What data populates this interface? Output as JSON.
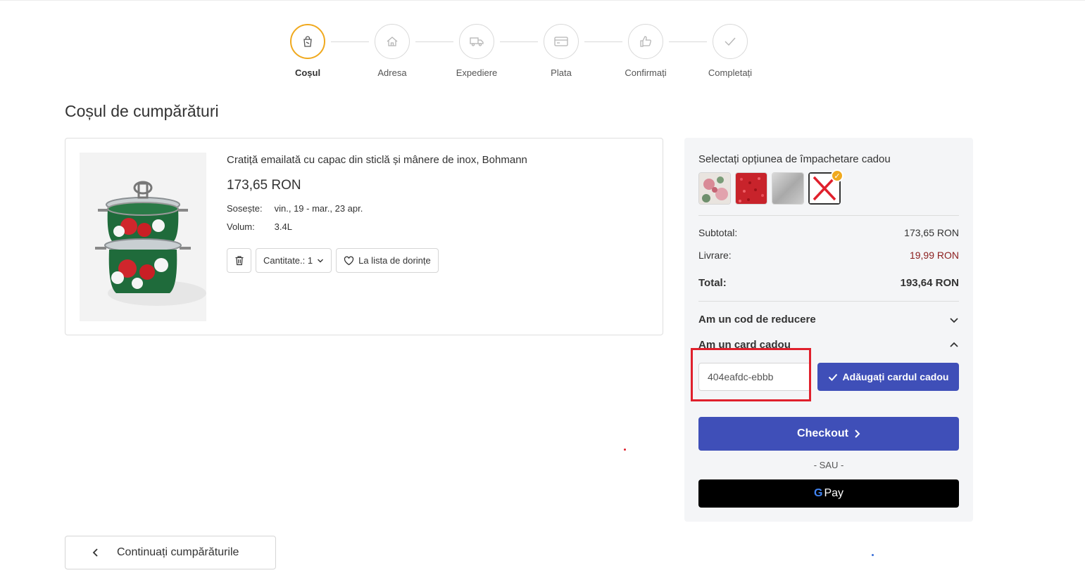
{
  "stepper": {
    "steps": [
      {
        "label": "Coșul",
        "icon": "shopping-bag-icon",
        "active": true
      },
      {
        "label": "Adresa",
        "icon": "home-icon",
        "active": false
      },
      {
        "label": "Expediere",
        "icon": "truck-icon",
        "active": false
      },
      {
        "label": "Plata",
        "icon": "credit-card-icon",
        "active": false
      },
      {
        "label": "Confirmați",
        "icon": "thumbs-up-icon",
        "active": false
      },
      {
        "label": "Completați",
        "icon": "check-icon",
        "active": false
      }
    ]
  },
  "page": {
    "title": "Coșul de cumpărături"
  },
  "product": {
    "name": "Cratiță emailată cu capac din sticlă și mânere de inox, Bohmann",
    "price": "173,65 RON",
    "arrives_label": "Sosește:",
    "arrives_value": "vin., 19 - mar., 23 apr.",
    "volume_label": "Volum:",
    "volume_value": "3.4L",
    "quantity_label": "Cantitate.: 1",
    "wishlist_label": "La lista de dorințe"
  },
  "summary": {
    "gift_wrap_title": "Selectați opțiunea de împachetare cadou",
    "subtotal_label": "Subtotal:",
    "subtotal_value": "173,65 RON",
    "delivery_label": "Livrare:",
    "delivery_value": "19,99 RON",
    "total_label": "Total:",
    "total_value": "193,64 RON",
    "discount_label": "Am un cod de reducere",
    "gift_card_label": "Am un card cadou",
    "gift_card_value": "404eafdc-ebbb",
    "add_gift_card_label": "Adăugați cardul cadou",
    "checkout_label": "Checkout",
    "or_label": "- SAU -",
    "gpay_label": "Pay",
    "gpay_g": "G"
  },
  "footer": {
    "continue_label": "Continuați cumpărăturile"
  },
  "colors": {
    "accent_blue": "#3f4fb8",
    "active_step": "#f0a91e",
    "delivery_price": "#8b1d1d",
    "highlight_red": "#e0202c"
  }
}
